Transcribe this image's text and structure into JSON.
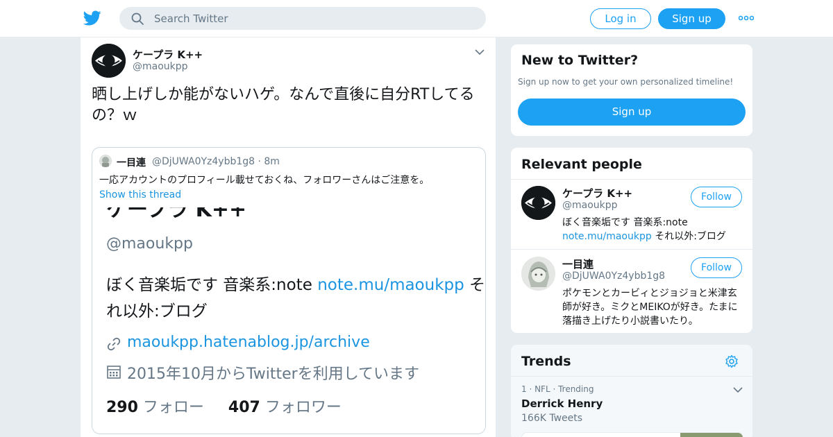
{
  "header": {
    "search_placeholder": "Search Twitter",
    "login_label": "Log in",
    "signup_label": "Sign up"
  },
  "tweet": {
    "author_name": "ケープラ K++",
    "author_handle": "@maoukpp",
    "text": "晒し上げしか能がないハゲ。なんで直後に自分RTしてるの？ｗ",
    "quote": {
      "name": "一目連",
      "handle_time": "@DjUWA0Yz4ybb1g8 · 8m",
      "text": "一応アカウントのプロフィール載せておくね、フォロワーさんはご注意を。",
      "thread_link": "Show this thread",
      "image": {
        "name": "ケープラ K++",
        "handle": "@maoukpp",
        "bio_line1": "ぼく音楽垢です 音楽系:note ",
        "bio_link": "note.mu/maoukpp",
        "bio_line1_tail": " そ",
        "bio_line2": "れ以外:ブログ",
        "website": "maoukpp.hatenablog.jp/archive",
        "joined": "2015年10月からTwitterを利用しています",
        "following_count": "290",
        "following_label": " フォロー",
        "followers_count": "407",
        "followers_label": " フォロワー"
      }
    }
  },
  "new_to_twitter": {
    "title": "New to Twitter?",
    "subtitle": "Sign up now to get your own personalized timeline!",
    "signup_label": "Sign up"
  },
  "relevant_people": {
    "title": "Relevant people",
    "people": [
      {
        "name": "ケープラ K++",
        "handle": "@maoukpp",
        "bio_prefix": "ぼく音楽垢です 音楽系:note ",
        "bio_link": "note.mu/maoukpp",
        "bio_suffix": " それ以外:ブログ",
        "follow_label": "Follow"
      },
      {
        "name": "一目連",
        "handle": "@DjUWA0Yz4ybb1g8",
        "bio": "ポケモンとカービィとジョジョと米津玄師が好き。ミクとMEIKOが好き。たまに落描き上げたり小説書いたり。",
        "follow_label": "Follow"
      }
    ]
  },
  "trends": {
    "title": "Trends",
    "items": [
      {
        "meta": "1 · NFL · Trending",
        "name": "Derrick Henry",
        "count": "166K Tweets"
      }
    ]
  },
  "colors": {
    "brand": "#1da1f2",
    "link": "#1b95e0",
    "text": "#14171a",
    "secondary": "#657786"
  }
}
